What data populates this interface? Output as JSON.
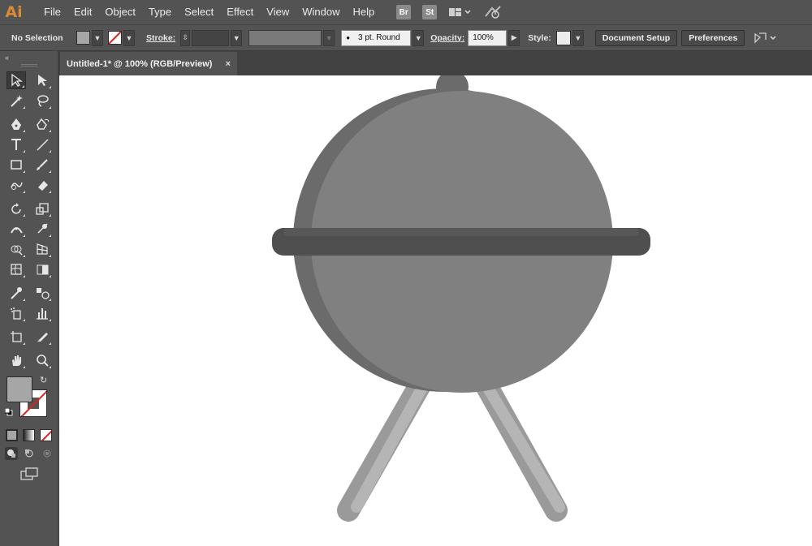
{
  "app": {
    "logo": "Ai"
  },
  "menu": [
    "File",
    "Edit",
    "Object",
    "Type",
    "Select",
    "Effect",
    "View",
    "Window",
    "Help"
  ],
  "menubar_icons": {
    "bridge": "Br",
    "stock": "St"
  },
  "control": {
    "selection": "No Selection",
    "stroke_label": "Stroke:",
    "brush": "3 pt. Round",
    "opacity_label": "Opacity:",
    "opacity_value": "100%",
    "style_label": "Style:",
    "document_setup": "Document Setup",
    "preferences": "Preferences"
  },
  "document": {
    "tab_title": "Untitled-1* @ 100% (RGB/Preview)",
    "close_glyph": "×"
  },
  "colors": {
    "fill": "#a6a6a6",
    "grill_dark": "#6b6b6b",
    "grill_main": "#808080",
    "band": "#4f4f4f",
    "leg_dark": "#9a9a9a",
    "leg_light": "#b5b5b5",
    "accent": "#d88b34"
  },
  "tools": [
    [
      "selection-tool-icon",
      "direct-selection-tool-icon"
    ],
    [
      "magic-wand-tool-icon",
      "lasso-tool-icon"
    ],
    [
      "pen-tool-icon",
      "curvature-tool-icon"
    ],
    [
      "type-tool-icon",
      "line-segment-tool-icon"
    ],
    [
      "rectangle-tool-icon",
      "paintbrush-tool-icon"
    ],
    [
      "shaper-tool-icon",
      "eraser-tool-icon"
    ],
    [
      "rotate-tool-icon",
      "scale-tool-icon"
    ],
    [
      "width-tool-icon",
      "puppet-warp-tool-icon"
    ],
    [
      "shape-builder-tool-icon",
      "perspective-grid-tool-icon"
    ],
    [
      "mesh-tool-icon",
      "gradient-tool-icon"
    ],
    [
      "eyedropper-tool-icon",
      "blend-tool-icon"
    ],
    [
      "symbol-sprayer-tool-icon",
      "column-graph-tool-icon"
    ],
    [
      "artboard-tool-icon",
      "slice-tool-icon"
    ],
    [
      "hand-tool-icon",
      "zoom-tool-icon"
    ]
  ]
}
